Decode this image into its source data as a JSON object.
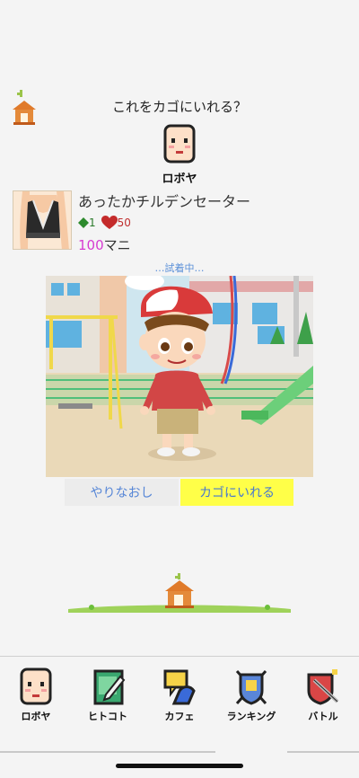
{
  "dialog": {
    "question": "これをカゴにいれる？",
    "shop_name": "ロボヤ"
  },
  "item": {
    "name": "あったかチルデンセーター",
    "defense": "1",
    "hp": "50",
    "price": "100",
    "currency": "マニ",
    "defense_icon": "green-diamond-icon",
    "hp_icon": "red-heart-icon"
  },
  "preview": {
    "status": "…試着中…"
  },
  "buttons": {
    "retry": "やりなおし",
    "add_to_cart": "カゴにいれる"
  },
  "tabs": [
    {
      "label": "ロボヤ",
      "icon": "face-icon"
    },
    {
      "label": "ヒトコト",
      "icon": "notebook-icon"
    },
    {
      "label": "カフェ",
      "icon": "cafe-icon"
    },
    {
      "label": "ランキング",
      "icon": "crest-icon"
    },
    {
      "label": "バトル",
      "icon": "shield-sword-icon"
    }
  ],
  "colors": {
    "price": "#d63cd1",
    "cart_button": "#ffff48",
    "link_text": "#5585d6"
  }
}
